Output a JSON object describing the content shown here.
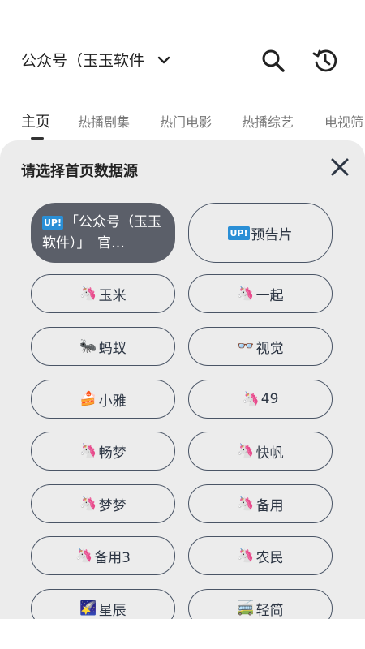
{
  "header": {
    "source_title": "公众号（玉玉软件",
    "dropdown_icon": "chevron-down-icon",
    "search_icon": "search-icon",
    "history_icon": "history-icon"
  },
  "tabs": [
    {
      "label": "主页"
    },
    {
      "label": "热播剧集"
    },
    {
      "label": "热门电影"
    },
    {
      "label": "热播综艺"
    },
    {
      "label": "电视筛"
    }
  ],
  "sheet": {
    "title": "请选择首页数据源",
    "close_icon": "close-icon",
    "options": [
      {
        "badge": "UP!",
        "emoji": "",
        "label": "「公众号（玉玉软件）」　官…"
      },
      {
        "badge": "UP!",
        "emoji": "",
        "label": "预告片"
      },
      {
        "badge": "",
        "emoji": "🦄",
        "label": "玉米"
      },
      {
        "badge": "",
        "emoji": "🦄",
        "label": "一起"
      },
      {
        "badge": "",
        "emoji": "🐜",
        "label": "蚂蚁"
      },
      {
        "badge": "",
        "emoji": "👓",
        "label": "视觉"
      },
      {
        "badge": "",
        "emoji": "🍰",
        "label": "小雅"
      },
      {
        "badge": "",
        "emoji": "🦄",
        "label": "49"
      },
      {
        "badge": "",
        "emoji": "🦄",
        "label": "畅梦"
      },
      {
        "badge": "",
        "emoji": "🦄",
        "label": "快帆"
      },
      {
        "badge": "",
        "emoji": "🦄",
        "label": "梦梦"
      },
      {
        "badge": "",
        "emoji": "🦄",
        "label": "备用"
      },
      {
        "badge": "",
        "emoji": "🦄",
        "label": "备用3"
      },
      {
        "badge": "",
        "emoji": "🦄",
        "label": "农民"
      },
      {
        "badge": "",
        "emoji": "🌠",
        "label": "星辰"
      },
      {
        "badge": "",
        "emoji": "🚎",
        "label": "轻简"
      }
    ],
    "selected_index": 0
  },
  "colors": {
    "sheet_bg": "#ececec",
    "chip_border": "#4a5566",
    "selected_bg": "#5b5f69",
    "up_badge": "#2a8fd6"
  }
}
